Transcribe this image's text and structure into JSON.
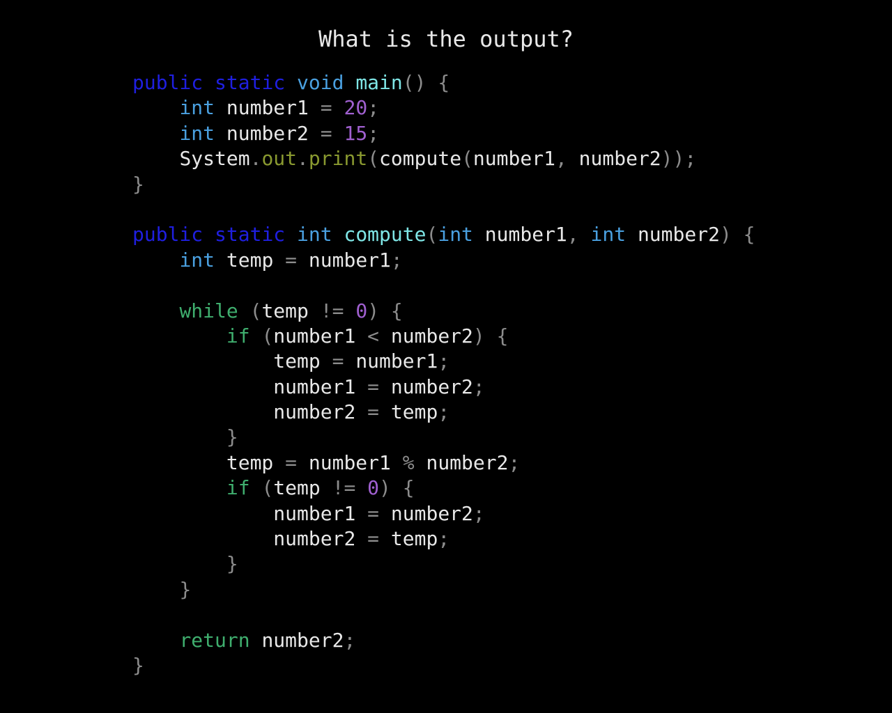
{
  "title": "What is the output?",
  "colors": {
    "background": "#000000",
    "keyword": "#1f1fe0",
    "type": "#4aa0e0",
    "function": "#7fe6e6",
    "control_flow": "#3fae6e",
    "number": "#a060d0",
    "member": "#8a9a30",
    "punctuation": "#8c8c8c",
    "identifier": "#e8e8e8"
  },
  "code_lines": [
    [
      [
        "keyword",
        "public"
      ],
      [
        "plain",
        " "
      ],
      [
        "keyword",
        "static"
      ],
      [
        "plain",
        " "
      ],
      [
        "type",
        "void"
      ],
      [
        "plain",
        " "
      ],
      [
        "func",
        "main"
      ],
      [
        "punct",
        "() {"
      ]
    ],
    [
      [
        "plain",
        "    "
      ],
      [
        "type",
        "int"
      ],
      [
        "plain",
        " "
      ],
      [
        "ident",
        "number1"
      ],
      [
        "plain",
        " "
      ],
      [
        "punct",
        "="
      ],
      [
        "plain",
        " "
      ],
      [
        "number",
        "20"
      ],
      [
        "punct",
        ";"
      ]
    ],
    [
      [
        "plain",
        "    "
      ],
      [
        "type",
        "int"
      ],
      [
        "plain",
        " "
      ],
      [
        "ident",
        "number2"
      ],
      [
        "plain",
        " "
      ],
      [
        "punct",
        "="
      ],
      [
        "plain",
        " "
      ],
      [
        "number",
        "15"
      ],
      [
        "punct",
        ";"
      ]
    ],
    [
      [
        "plain",
        "    "
      ],
      [
        "ident",
        "System"
      ],
      [
        "punct",
        "."
      ],
      [
        "member",
        "out"
      ],
      [
        "punct",
        "."
      ],
      [
        "member",
        "print"
      ],
      [
        "punct",
        "("
      ],
      [
        "ident",
        "compute"
      ],
      [
        "punct",
        "("
      ],
      [
        "ident",
        "number1"
      ],
      [
        "punct",
        ","
      ],
      [
        "plain",
        " "
      ],
      [
        "ident",
        "number2"
      ],
      [
        "punct",
        "));"
      ]
    ],
    [
      [
        "punct",
        "}"
      ]
    ],
    [],
    [
      [
        "keyword",
        "public"
      ],
      [
        "plain",
        " "
      ],
      [
        "keyword",
        "static"
      ],
      [
        "plain",
        " "
      ],
      [
        "type",
        "int"
      ],
      [
        "plain",
        " "
      ],
      [
        "func",
        "compute"
      ],
      [
        "punct",
        "("
      ],
      [
        "type",
        "int"
      ],
      [
        "plain",
        " "
      ],
      [
        "ident",
        "number1"
      ],
      [
        "punct",
        ","
      ],
      [
        "plain",
        " "
      ],
      [
        "type",
        "int"
      ],
      [
        "plain",
        " "
      ],
      [
        "ident",
        "number2"
      ],
      [
        "punct",
        ") {"
      ]
    ],
    [
      [
        "plain",
        "    "
      ],
      [
        "type",
        "int"
      ],
      [
        "plain",
        " "
      ],
      [
        "ident",
        "temp"
      ],
      [
        "plain",
        " "
      ],
      [
        "punct",
        "="
      ],
      [
        "plain",
        " "
      ],
      [
        "ident",
        "number1"
      ],
      [
        "punct",
        ";"
      ]
    ],
    [],
    [
      [
        "plain",
        "    "
      ],
      [
        "flow",
        "while"
      ],
      [
        "plain",
        " "
      ],
      [
        "punct",
        "("
      ],
      [
        "ident",
        "temp"
      ],
      [
        "plain",
        " "
      ],
      [
        "punct",
        "!="
      ],
      [
        "plain",
        " "
      ],
      [
        "number",
        "0"
      ],
      [
        "punct",
        ") {"
      ]
    ],
    [
      [
        "plain",
        "        "
      ],
      [
        "flow",
        "if"
      ],
      [
        "plain",
        " "
      ],
      [
        "punct",
        "("
      ],
      [
        "ident",
        "number1"
      ],
      [
        "plain",
        " "
      ],
      [
        "punct",
        "<"
      ],
      [
        "plain",
        " "
      ],
      [
        "ident",
        "number2"
      ],
      [
        "punct",
        ") {"
      ]
    ],
    [
      [
        "plain",
        "            "
      ],
      [
        "ident",
        "temp"
      ],
      [
        "plain",
        " "
      ],
      [
        "punct",
        "="
      ],
      [
        "plain",
        " "
      ],
      [
        "ident",
        "number1"
      ],
      [
        "punct",
        ";"
      ]
    ],
    [
      [
        "plain",
        "            "
      ],
      [
        "ident",
        "number1"
      ],
      [
        "plain",
        " "
      ],
      [
        "punct",
        "="
      ],
      [
        "plain",
        " "
      ],
      [
        "ident",
        "number2"
      ],
      [
        "punct",
        ";"
      ]
    ],
    [
      [
        "plain",
        "            "
      ],
      [
        "ident",
        "number2"
      ],
      [
        "plain",
        " "
      ],
      [
        "punct",
        "="
      ],
      [
        "plain",
        " "
      ],
      [
        "ident",
        "temp"
      ],
      [
        "punct",
        ";"
      ]
    ],
    [
      [
        "plain",
        "        "
      ],
      [
        "punct",
        "}"
      ]
    ],
    [
      [
        "plain",
        "        "
      ],
      [
        "ident",
        "temp"
      ],
      [
        "plain",
        " "
      ],
      [
        "punct",
        "="
      ],
      [
        "plain",
        " "
      ],
      [
        "ident",
        "number1"
      ],
      [
        "plain",
        " "
      ],
      [
        "punct",
        "%"
      ],
      [
        "plain",
        " "
      ],
      [
        "ident",
        "number2"
      ],
      [
        "punct",
        ";"
      ]
    ],
    [
      [
        "plain",
        "        "
      ],
      [
        "flow",
        "if"
      ],
      [
        "plain",
        " "
      ],
      [
        "punct",
        "("
      ],
      [
        "ident",
        "temp"
      ],
      [
        "plain",
        " "
      ],
      [
        "punct",
        "!="
      ],
      [
        "plain",
        " "
      ],
      [
        "number",
        "0"
      ],
      [
        "punct",
        ") {"
      ]
    ],
    [
      [
        "plain",
        "            "
      ],
      [
        "ident",
        "number1"
      ],
      [
        "plain",
        " "
      ],
      [
        "punct",
        "="
      ],
      [
        "plain",
        " "
      ],
      [
        "ident",
        "number2"
      ],
      [
        "punct",
        ";"
      ]
    ],
    [
      [
        "plain",
        "            "
      ],
      [
        "ident",
        "number2"
      ],
      [
        "plain",
        " "
      ],
      [
        "punct",
        "="
      ],
      [
        "plain",
        " "
      ],
      [
        "ident",
        "temp"
      ],
      [
        "punct",
        ";"
      ]
    ],
    [
      [
        "plain",
        "        "
      ],
      [
        "punct",
        "}"
      ]
    ],
    [
      [
        "plain",
        "    "
      ],
      [
        "punct",
        "}"
      ]
    ],
    [],
    [
      [
        "plain",
        "    "
      ],
      [
        "flow",
        "return"
      ],
      [
        "plain",
        " "
      ],
      [
        "ident",
        "number2"
      ],
      [
        "punct",
        ";"
      ]
    ],
    [
      [
        "punct",
        "}"
      ]
    ]
  ]
}
